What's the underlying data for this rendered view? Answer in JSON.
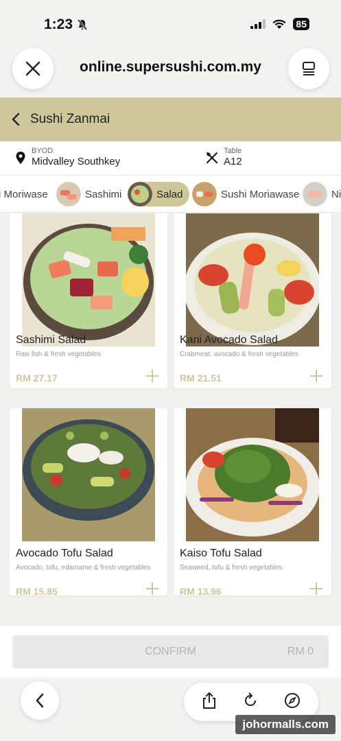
{
  "status": {
    "time": "1:23",
    "battery": "85"
  },
  "browser": {
    "url": "online.supersushi.com.my"
  },
  "header": {
    "title": "Sushi Zanmai"
  },
  "info": {
    "mode_label": "BYOD",
    "location": "Midvalley Southkey",
    "table_label": "Table",
    "table": "A12"
  },
  "categories": [
    {
      "label": "i Moriwase",
      "active": false
    },
    {
      "label": "Sashimi",
      "active": false
    },
    {
      "label": "Salad",
      "active": true
    },
    {
      "label": "Sushi Moriawase",
      "active": false
    },
    {
      "label": "Nig",
      "active": false
    }
  ],
  "items": [
    {
      "name": "Sashimi Salad",
      "desc": "Raw fish & fresh vegetables",
      "price": "RM 27.17"
    },
    {
      "name": "Kani Avocado Salad",
      "desc": "Crabmeat, avocado & fresh vegetables",
      "price": "RM 21.51"
    },
    {
      "name": "Avocado Tofu Salad",
      "desc": "Avocado, tofu, edamame & fresh vegetables",
      "price": "RM 15.85"
    },
    {
      "name": "Kaiso Tofu Salad",
      "desc": "Seaweed, tofu & fresh vegetables",
      "price": "RM 13.96"
    }
  ],
  "confirm": {
    "label": "CONFIRM",
    "total": "RM 0"
  },
  "watermark": "johormalls.com",
  "colors": {
    "accent": "#cdc79a",
    "price": "#cdc79a"
  }
}
